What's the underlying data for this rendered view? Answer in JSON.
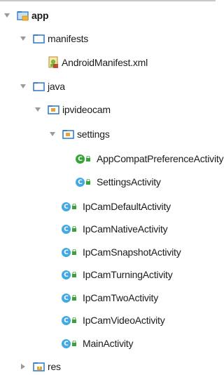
{
  "tree": {
    "app": "app",
    "manifests": "manifests",
    "android_manifest": "AndroidManifest.xml",
    "java": "java",
    "ipvideocam": "ipvideocam",
    "settings": "settings",
    "app_compat_pref": "AppCompatPreferenceActivity",
    "settings_activity": "SettingsActivity",
    "classes": [
      "IpCamDefaultActivity",
      "IpCamNativeActivity",
      "IpCamSnapshotActivity",
      "IpCamTurningActivity",
      "IpCamTwoActivity",
      "IpCamVideoActivity",
      "MainActivity"
    ],
    "res": "res"
  },
  "colors": {
    "folder_blue": "#3b7fc4",
    "folder_orange": "#e3a63b",
    "class_badge": "#44a8e5",
    "abstract_badge": "#3aa23a",
    "arrow": "#9a9a9a"
  }
}
